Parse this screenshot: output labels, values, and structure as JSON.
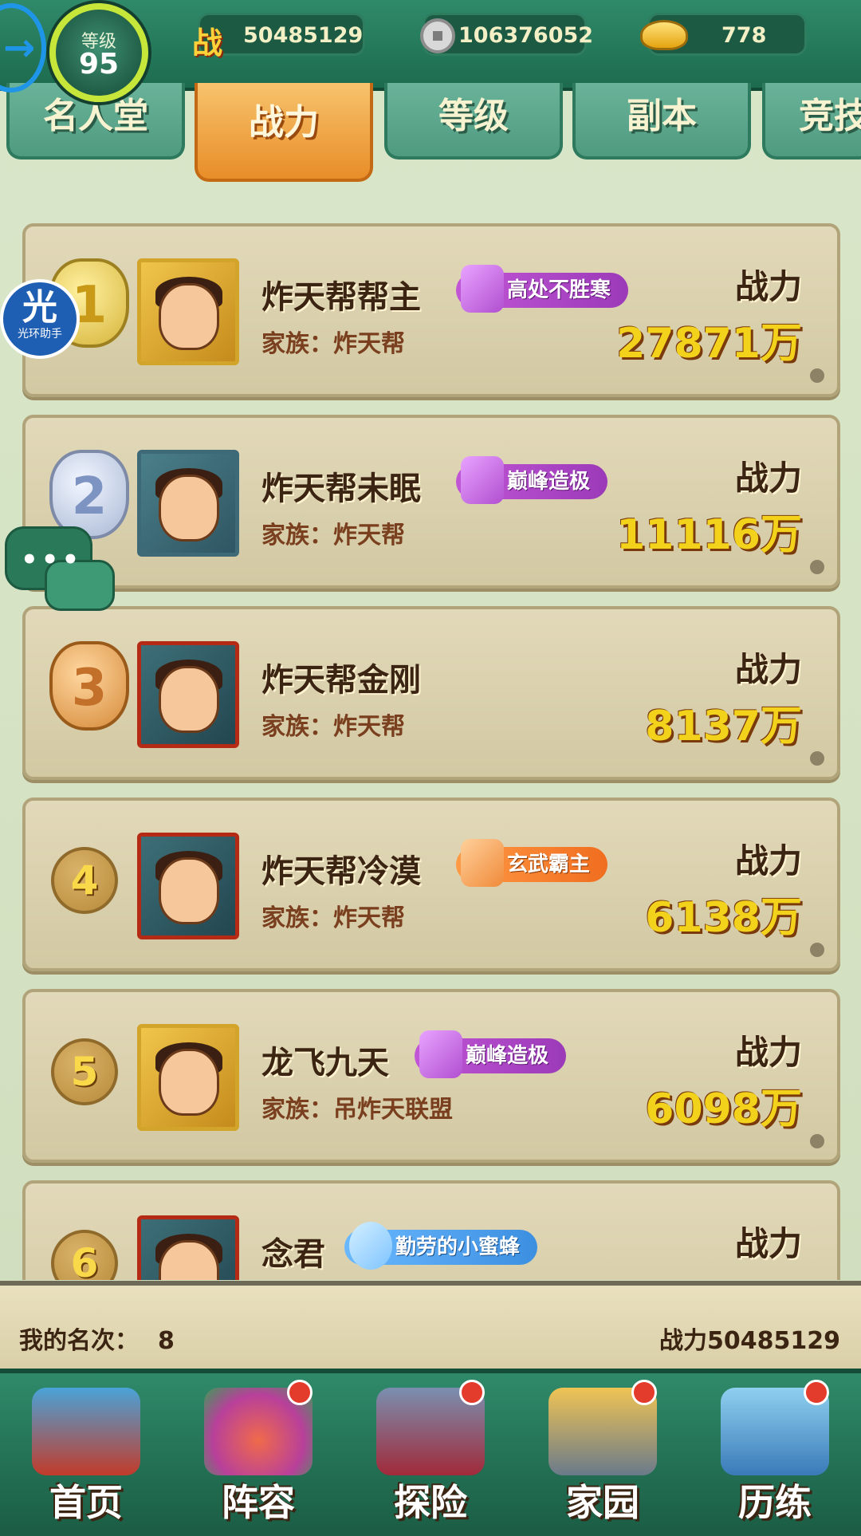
{
  "header": {
    "level_label": "等级",
    "level_value": "95",
    "back_icon": "arrow-right-icon",
    "resources": [
      {
        "icon": "zhan-icon",
        "icon_text": "战",
        "value": "50485129"
      },
      {
        "icon": "coin-icon",
        "icon_text": "",
        "value": "106376052"
      },
      {
        "icon": "gold-ingot-icon",
        "icon_text": "",
        "value": "778"
      }
    ]
  },
  "tabs": [
    {
      "label": "名人堂",
      "active": false
    },
    {
      "label": "战力",
      "active": true
    },
    {
      "label": "等级",
      "active": false
    },
    {
      "label": "副本",
      "active": false
    },
    {
      "label": "竞技",
      "active": false
    }
  ],
  "helper": {
    "glyph": "光",
    "label": "光环助手"
  },
  "chat": {
    "dots": "•••"
  },
  "ranking": [
    {
      "rank": "1",
      "medal": "gold",
      "name": "炸天帮帮主",
      "title": "高处不胜寒",
      "title_style": "purple",
      "family": "家族：炸天帮",
      "power_label": "战力",
      "power": "27871万"
    },
    {
      "rank": "2",
      "medal": "silver",
      "name": "炸天帮未眠",
      "title": "巅峰造极",
      "title_style": "purple",
      "family": "家族：炸天帮",
      "power_label": "战力",
      "power": "11116万"
    },
    {
      "rank": "3",
      "medal": "bronze",
      "name": "炸天帮金刚",
      "title": "",
      "title_style": "",
      "family": "家族：炸天帮",
      "power_label": "战力",
      "power": "8137万"
    },
    {
      "rank": "4",
      "medal": "",
      "name": "炸天帮冷漠",
      "title": "玄武霸主",
      "title_style": "orange",
      "family": "家族：炸天帮",
      "power_label": "战力",
      "power": "6138万"
    },
    {
      "rank": "5",
      "medal": "",
      "name": "龙飞九天",
      "title": "巅峰造极",
      "title_style": "purple",
      "family": "家族：吊炸天联盟",
      "power_label": "战力",
      "power": "6098万"
    },
    {
      "rank": "6",
      "medal": "",
      "name": "念君",
      "title": "勤劳的小蜜蜂",
      "title_style": "blue",
      "family": "",
      "power_label": "战力",
      "power": ""
    }
  ],
  "my_rank": {
    "label": "我的名次：",
    "value": "8",
    "power": "战力50485129"
  },
  "nav": [
    {
      "label": "首页",
      "icon": "palace-gate-icon",
      "badge": false
    },
    {
      "label": "阵容",
      "icon": "gourd-brothers-icon",
      "badge": true
    },
    {
      "label": "探险",
      "icon": "cave-door-icon",
      "badge": true
    },
    {
      "label": "家园",
      "icon": "cottage-icon",
      "badge": true
    },
    {
      "label": "历练",
      "icon": "mountain-sword-icon",
      "badge": true
    }
  ],
  "colors": {
    "accent_green": "#2f8a6a",
    "tab_active": "#e88d28",
    "power_yellow": "#f2d21a"
  }
}
